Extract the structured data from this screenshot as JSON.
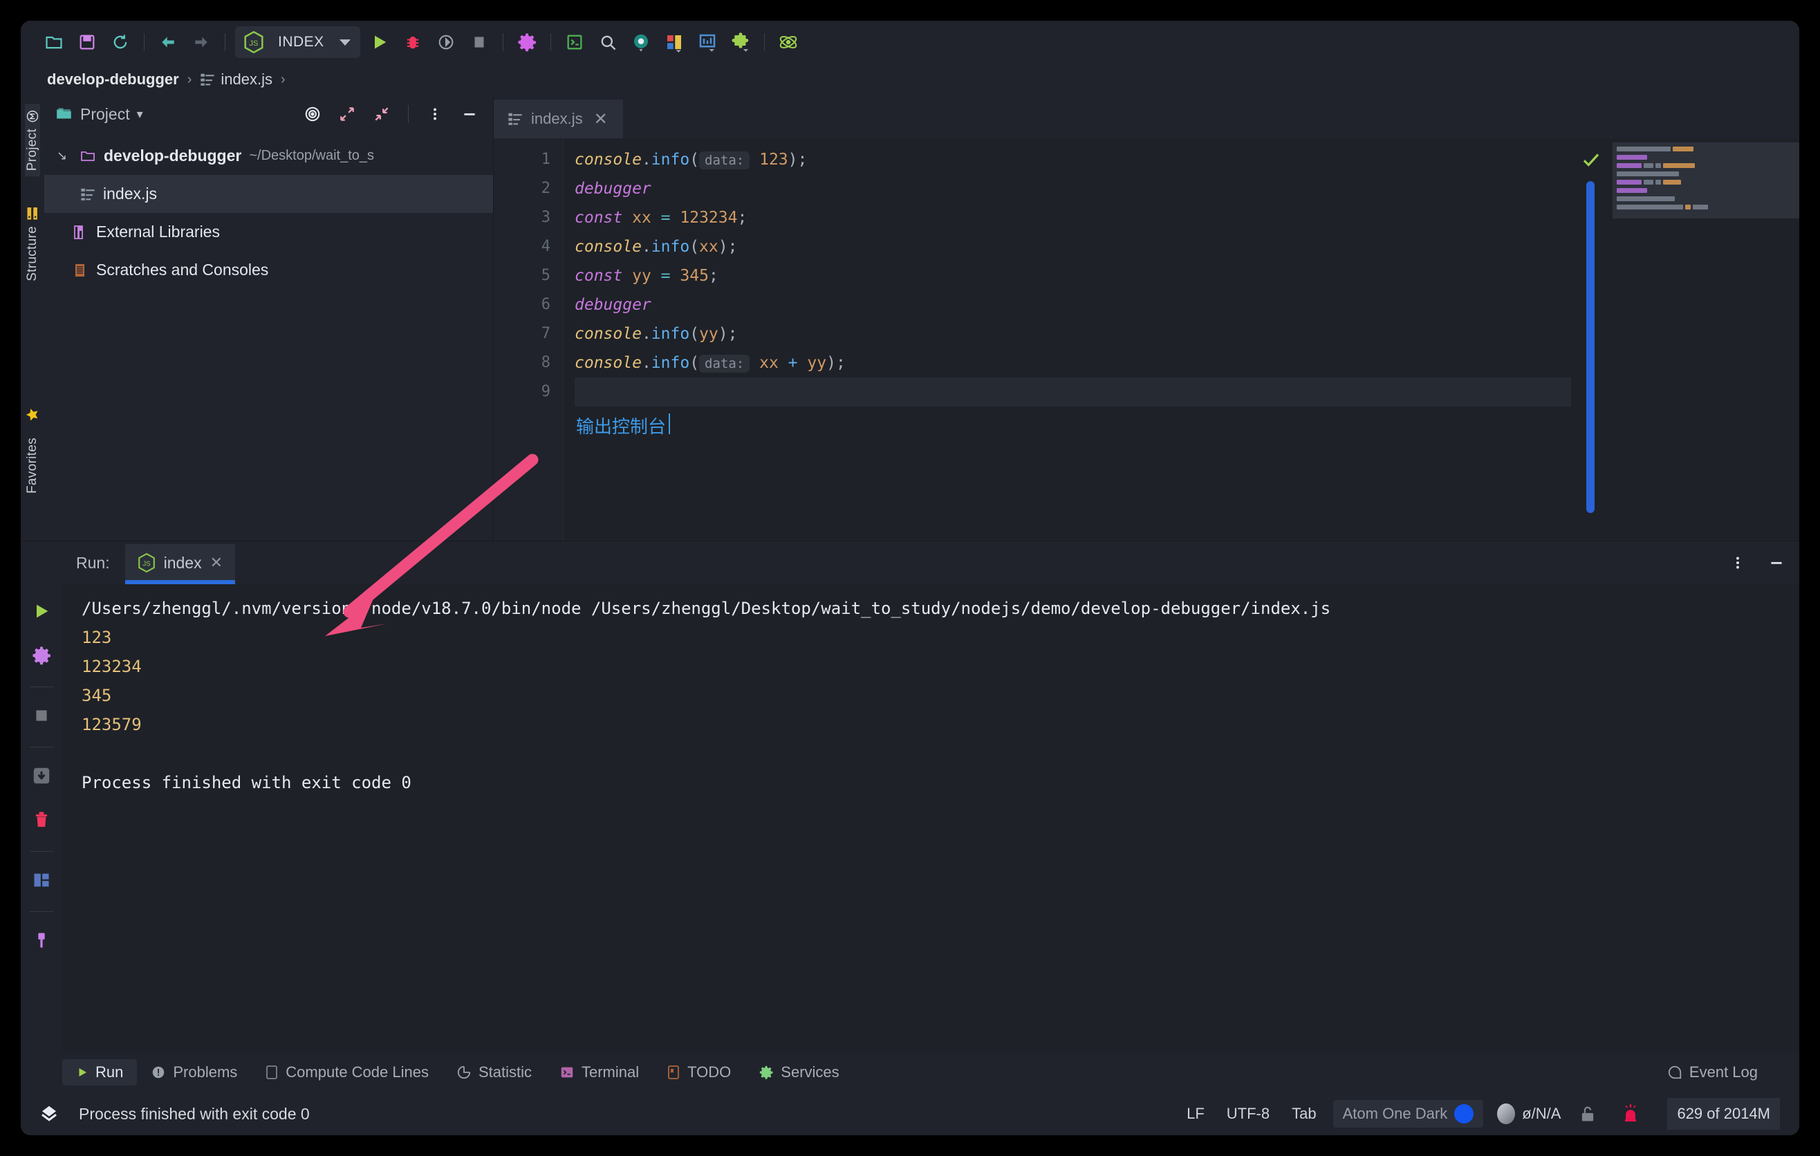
{
  "toolbar": {
    "buttons": [
      {
        "name": "open-folder-icon",
        "label": "Open"
      },
      {
        "name": "save-all-icon",
        "label": "Save All"
      },
      {
        "name": "sync-icon",
        "label": "Synchronize"
      },
      {
        "name": "back-arrow-icon",
        "label": "Back"
      },
      {
        "name": "forward-arrow-icon",
        "label": "Forward"
      }
    ],
    "run_config": {
      "name": "INDEX",
      "icon": "js-node-icon"
    },
    "actions": [
      {
        "name": "run-icon",
        "label": "Run"
      },
      {
        "name": "debug-bug-icon",
        "label": "Debug"
      },
      {
        "name": "run-coverage-icon",
        "label": "Run with Coverage"
      },
      {
        "name": "stop-icon",
        "label": "Stop"
      },
      {
        "name": "settings-gear-icon",
        "label": "Settings"
      },
      {
        "name": "terminal-icon",
        "label": "Terminal"
      },
      {
        "name": "search-icon",
        "label": "Search Everywhere"
      },
      {
        "name": "inspect-icon",
        "label": "Inspect"
      },
      {
        "name": "layout-icon",
        "label": "Layout"
      },
      {
        "name": "chart-icon",
        "label": "Statistic"
      },
      {
        "name": "plugin-puzzle-icon",
        "label": "Plugins"
      },
      {
        "name": "atom-icon",
        "label": "Atom"
      }
    ]
  },
  "breadcrumb": {
    "project": "develop-debugger",
    "file": "index.js",
    "separator": "›"
  },
  "left_rail": {
    "top_items": [
      {
        "label": "Project",
        "icon": "project-module-icon",
        "active": true
      },
      {
        "label": "Structure",
        "icon": "structure-icon",
        "active": false
      }
    ],
    "bottom_items": [
      {
        "label": "Favorites",
        "icon": "star-icon",
        "active": false
      }
    ]
  },
  "project_panel": {
    "title": "Project",
    "header_icons": [
      {
        "name": "locate-target-icon"
      },
      {
        "name": "expand-all-icon"
      },
      {
        "name": "collapse-all-icon"
      },
      {
        "name": "more-options-icon"
      },
      {
        "name": "hide-panel-icon"
      }
    ],
    "tree": [
      {
        "label": "develop-debugger",
        "path": "~/Desktop/wait_to_s",
        "icon": "folder-icon",
        "twisty": "↘",
        "bold": true,
        "selected": false,
        "indent": 0
      },
      {
        "label": "index.js",
        "path": "",
        "icon": "js-file-icon",
        "twisty": "",
        "bold": false,
        "selected": true,
        "indent": 1
      },
      {
        "label": "External Libraries",
        "path": "",
        "icon": "library-icon",
        "twisty": "",
        "bold": false,
        "selected": false,
        "indent": 0
      },
      {
        "label": "Scratches and Consoles",
        "path": "",
        "icon": "scratches-icon",
        "twisty": "",
        "bold": false,
        "selected": false,
        "indent": 0
      }
    ]
  },
  "editor": {
    "tab": {
      "label": "index.js",
      "icon": "js-file-icon",
      "close": "✕"
    },
    "line_numbers": [
      "1",
      "2",
      "3",
      "4",
      "5",
      "6",
      "7",
      "8",
      "9"
    ],
    "lines": [
      {
        "n": 1,
        "tokens": [
          {
            "t": "obj",
            "v": "console"
          },
          {
            "t": "punc",
            "v": "."
          },
          {
            "t": "fn",
            "v": "info"
          },
          {
            "t": "punc",
            "v": "("
          },
          {
            "t": "hint",
            "v": "data:"
          },
          {
            "t": "num",
            "v": "123"
          },
          {
            "t": "punc",
            "v": ");"
          }
        ]
      },
      {
        "n": 2,
        "tokens": [
          {
            "t": "kw",
            "v": "debugger"
          }
        ]
      },
      {
        "n": 3,
        "tokens": [
          {
            "t": "kw",
            "v": "const"
          },
          {
            "t": "plain",
            "v": " "
          },
          {
            "t": "var",
            "v": "xx"
          },
          {
            "t": "plain",
            "v": " "
          },
          {
            "t": "op",
            "v": "="
          },
          {
            "t": "plain",
            "v": " "
          },
          {
            "t": "num",
            "v": "123234"
          },
          {
            "t": "punc",
            "v": ";"
          }
        ]
      },
      {
        "n": 4,
        "tokens": [
          {
            "t": "obj",
            "v": "console"
          },
          {
            "t": "punc",
            "v": "."
          },
          {
            "t": "fn",
            "v": "info"
          },
          {
            "t": "punc",
            "v": "("
          },
          {
            "t": "var",
            "v": "xx"
          },
          {
            "t": "punc",
            "v": ");"
          }
        ]
      },
      {
        "n": 5,
        "tokens": [
          {
            "t": "kw",
            "v": "const"
          },
          {
            "t": "plain",
            "v": " "
          },
          {
            "t": "var",
            "v": "yy"
          },
          {
            "t": "plain",
            "v": " "
          },
          {
            "t": "op",
            "v": "="
          },
          {
            "t": "plain",
            "v": " "
          },
          {
            "t": "num",
            "v": "345"
          },
          {
            "t": "punc",
            "v": ";"
          }
        ]
      },
      {
        "n": 6,
        "tokens": [
          {
            "t": "kw",
            "v": "debugger"
          }
        ]
      },
      {
        "n": 7,
        "tokens": [
          {
            "t": "obj",
            "v": "console"
          },
          {
            "t": "punc",
            "v": "."
          },
          {
            "t": "fn",
            "v": "info"
          },
          {
            "t": "punc",
            "v": "("
          },
          {
            "t": "var",
            "v": "yy"
          },
          {
            "t": "punc",
            "v": ");"
          }
        ]
      },
      {
        "n": 8,
        "tokens": [
          {
            "t": "obj",
            "v": "console"
          },
          {
            "t": "punc",
            "v": "."
          },
          {
            "t": "fn",
            "v": "info"
          },
          {
            "t": "punc",
            "v": "("
          },
          {
            "t": "hint",
            "v": "data:"
          },
          {
            "t": "var",
            "v": "xx"
          },
          {
            "t": "plain",
            "v": " "
          },
          {
            "t": "plus",
            "v": "+"
          },
          {
            "t": "plain",
            "v": " "
          },
          {
            "t": "var",
            "v": "yy"
          },
          {
            "t": "punc",
            "v": ");"
          }
        ]
      },
      {
        "n": 9,
        "tokens": []
      }
    ],
    "annotation": "输出控制台",
    "inspection_status": "ok-check-icon"
  },
  "run_panel": {
    "label": "Run:",
    "tab": {
      "label": "index",
      "icon": "js-node-icon",
      "close": "✕"
    },
    "header_icons": [
      {
        "name": "more-options-icon"
      },
      {
        "name": "hide-panel-icon"
      }
    ],
    "gutter_buttons": [
      {
        "name": "rerun-icon",
        "label": "Rerun"
      },
      {
        "name": "settings-gear-icon",
        "label": "Settings"
      },
      {
        "name": "stop-icon",
        "label": "Stop"
      },
      {
        "name": "scroll-to-end-icon",
        "label": "Scroll to End"
      },
      {
        "name": "trash-icon",
        "label": "Clear All"
      },
      {
        "name": "print-layout-icon",
        "label": "Print"
      },
      {
        "name": "pin-icon",
        "label": "Pin Tab"
      }
    ],
    "console": {
      "command": "/Users/zhenggl/.nvm/versions/node/v18.7.0/bin/node /Users/zhenggl/Desktop/wait_to_study/nodejs/demo/develop-debugger/index.js",
      "outputs": [
        "123",
        "123234",
        "345",
        "123579"
      ],
      "finished": "Process finished with exit code 0"
    }
  },
  "tool_window_bar": {
    "items": [
      {
        "label": "Run",
        "icon": "run-icon",
        "active": true
      },
      {
        "label": "Problems",
        "icon": "problems-icon",
        "active": false
      },
      {
        "label": "Compute Code Lines",
        "icon": "compute-lines-icon",
        "active": false
      },
      {
        "label": "Statistic",
        "icon": "statistic-icon",
        "active": false
      },
      {
        "label": "Terminal",
        "icon": "terminal-icon",
        "active": false
      },
      {
        "label": "TODO",
        "icon": "todo-icon",
        "active": false
      },
      {
        "label": "Services",
        "icon": "services-icon",
        "active": false
      }
    ],
    "event_log": {
      "label": "Event Log",
      "icon": "event-log-icon"
    }
  },
  "status_bar": {
    "message": "Process finished with exit code 0",
    "line_separator": "LF",
    "encoding": "UTF-8",
    "indent": "Tab",
    "theme": "Atom One Dark",
    "git_branch": "ø/N/A",
    "memory": "629 of 2014M",
    "icons": [
      {
        "name": "ide-logo-icon"
      },
      {
        "name": "lock-icon"
      },
      {
        "name": "notification-bell-icon"
      }
    ]
  },
  "colors": {
    "accent_blue": "#2a6ce0",
    "annotation_blue": "#3d9ae8",
    "arrow_pink": "#ef4d7f",
    "panel_bg": "#20232b",
    "editor_bg": "#1e2127",
    "string_yellow": "#e5c07b",
    "keyword_purple": "#c678dd"
  }
}
